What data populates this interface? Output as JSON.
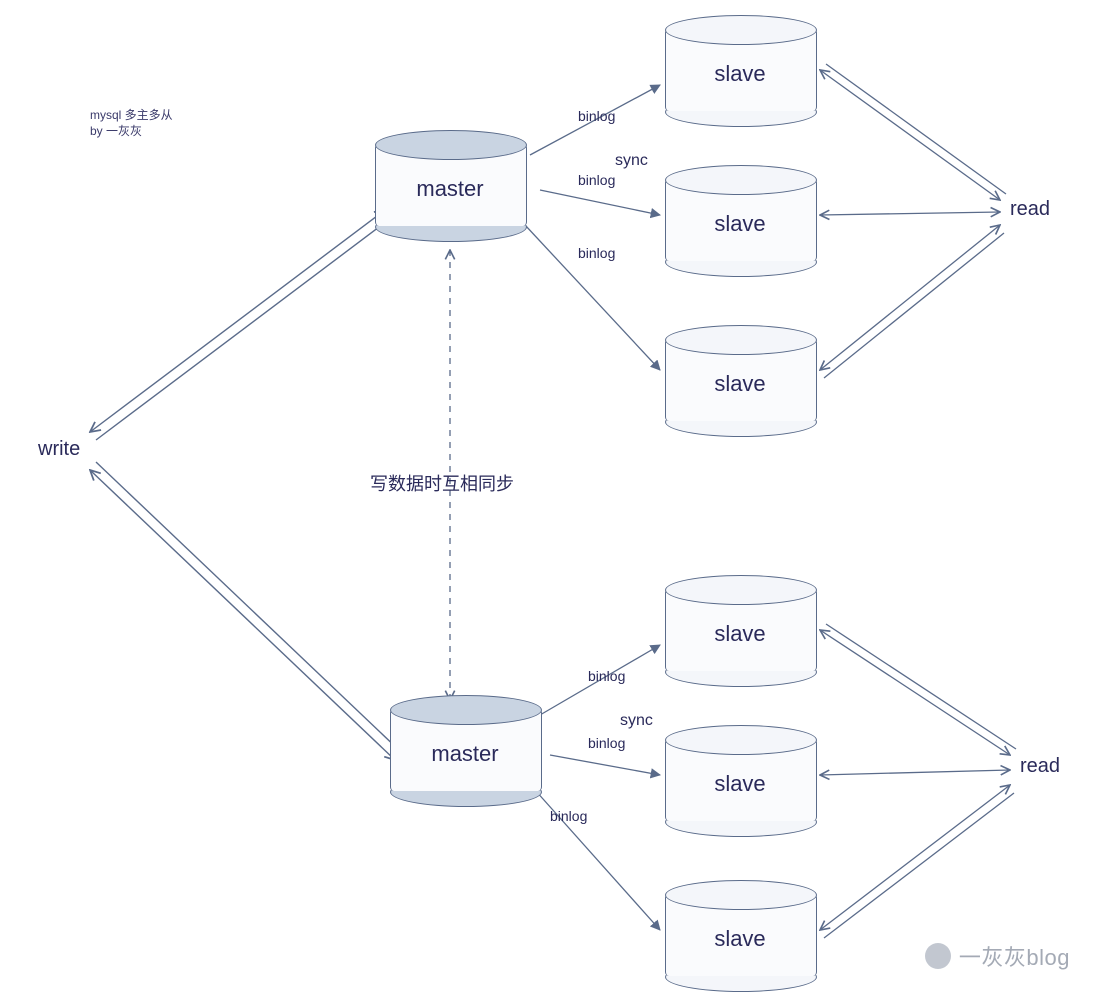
{
  "title_note": {
    "line1": "mysql 多主多从",
    "line2": "by 一灰灰"
  },
  "labels": {
    "write": "write",
    "read_top": "read",
    "read_bottom": "read",
    "sync_note": "写数据时互相同步",
    "sync_top": "sync",
    "sync_bottom": "sync",
    "binlog_t1": "binlog",
    "binlog_t2": "binlog",
    "binlog_t3": "binlog",
    "binlog_b1": "binlog",
    "binlog_b2": "binlog",
    "binlog_b3": "binlog"
  },
  "nodes": {
    "master_top": "master",
    "master_bottom": "master",
    "slave_t1": "slave",
    "slave_t2": "slave",
    "slave_t3": "slave",
    "slave_b1": "slave",
    "slave_b2": "slave",
    "slave_b3": "slave"
  },
  "watermark": "一灰灰blog",
  "chart_data": {
    "type": "diagram",
    "title": "MySQL 多主多从 (multi-master multi-slave) replication topology",
    "nodes": [
      {
        "id": "write",
        "kind": "actor",
        "label": "write"
      },
      {
        "id": "master1",
        "kind": "database-master",
        "label": "master"
      },
      {
        "id": "master2",
        "kind": "database-master",
        "label": "master"
      },
      {
        "id": "slave1a",
        "kind": "database-slave",
        "label": "slave",
        "group": "top"
      },
      {
        "id": "slave1b",
        "kind": "database-slave",
        "label": "slave",
        "group": "top"
      },
      {
        "id": "slave1c",
        "kind": "database-slave",
        "label": "slave",
        "group": "top"
      },
      {
        "id": "slave2a",
        "kind": "database-slave",
        "label": "slave",
        "group": "bottom"
      },
      {
        "id": "slave2b",
        "kind": "database-slave",
        "label": "slave",
        "group": "bottom"
      },
      {
        "id": "slave2c",
        "kind": "database-slave",
        "label": "slave",
        "group": "bottom"
      },
      {
        "id": "read1",
        "kind": "actor",
        "label": "read",
        "group": "top"
      },
      {
        "id": "read2",
        "kind": "actor",
        "label": "read",
        "group": "bottom"
      }
    ],
    "edges": [
      {
        "from": "write",
        "to": "master1",
        "dir": "both"
      },
      {
        "from": "write",
        "to": "master2",
        "dir": "both"
      },
      {
        "from": "master1",
        "to": "master2",
        "dir": "both",
        "style": "dashed",
        "label": "写数据时互相同步"
      },
      {
        "from": "master1",
        "to": "slave1a",
        "dir": "forward",
        "label": "binlog"
      },
      {
        "from": "master1",
        "to": "slave1b",
        "dir": "forward",
        "label": "binlog / sync"
      },
      {
        "from": "master1",
        "to": "slave1c",
        "dir": "forward",
        "label": "binlog"
      },
      {
        "from": "master2",
        "to": "slave2a",
        "dir": "forward",
        "label": "binlog"
      },
      {
        "from": "master2",
        "to": "slave2b",
        "dir": "forward",
        "label": "binlog / sync"
      },
      {
        "from": "master2",
        "to": "slave2c",
        "dir": "forward",
        "label": "binlog"
      },
      {
        "from": "slave1a",
        "to": "read1",
        "dir": "both"
      },
      {
        "from": "slave1b",
        "to": "read1",
        "dir": "both"
      },
      {
        "from": "slave1c",
        "to": "read1",
        "dir": "both"
      },
      {
        "from": "slave2a",
        "to": "read2",
        "dir": "both"
      },
      {
        "from": "slave2b",
        "to": "read2",
        "dir": "both"
      },
      {
        "from": "slave2c",
        "to": "read2",
        "dir": "both"
      }
    ]
  }
}
